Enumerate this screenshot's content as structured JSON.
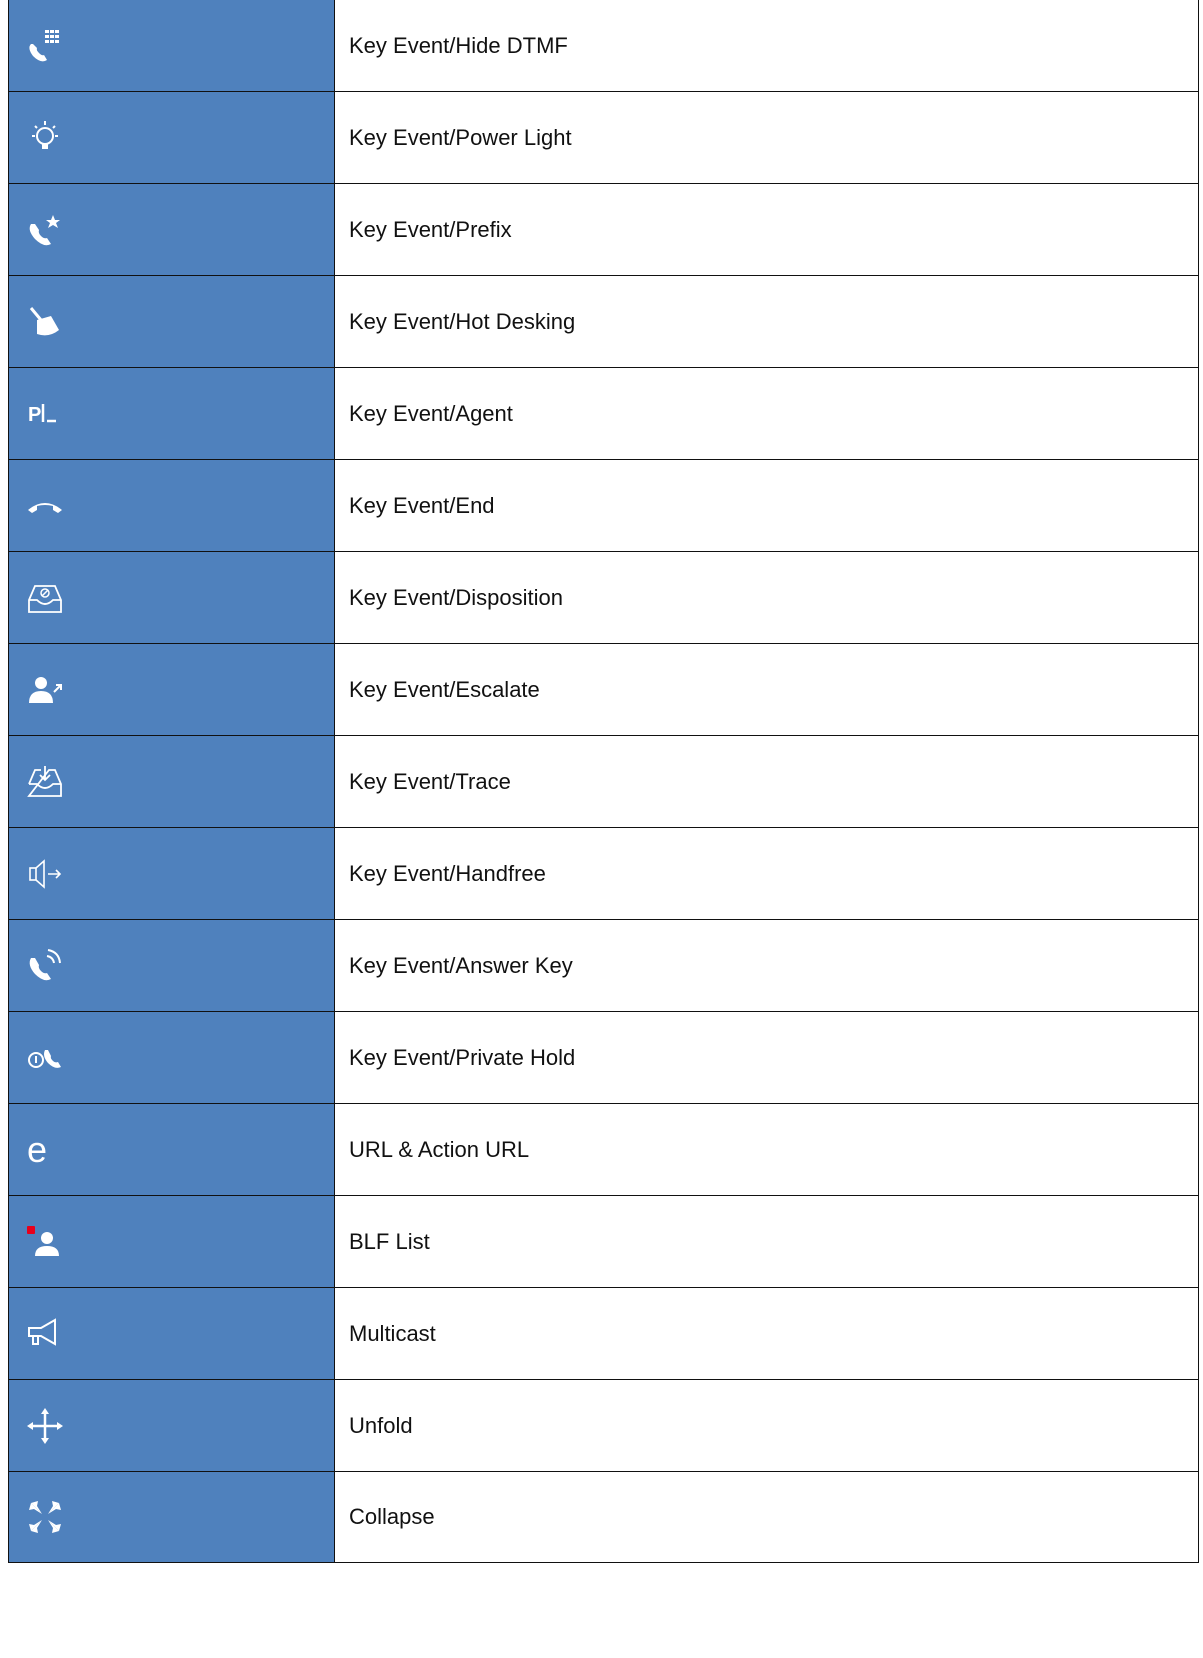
{
  "table": {
    "accent_color": "#4f81bd",
    "rows": [
      {
        "icon": "dialpad-phone-icon",
        "label": "Key Event/Hide DTMF"
      },
      {
        "icon": "light-bulb-icon",
        "label": "Key Event/Power Light"
      },
      {
        "icon": "phone-star-icon",
        "label": "Key Event/Prefix"
      },
      {
        "icon": "broom-icon",
        "label": "Key Event/Hot Desking"
      },
      {
        "icon": "agent-p-icon",
        "label": "Key Event/Agent"
      },
      {
        "icon": "end-call-icon",
        "label": "Key Event/End"
      },
      {
        "icon": "inbox-disposition-icon",
        "label": "Key Event/Disposition"
      },
      {
        "icon": "user-escalate-icon",
        "label": "Key Event/Escalate"
      },
      {
        "icon": "inbox-trace-icon",
        "label": "Key Event/Trace"
      },
      {
        "icon": "speaker-handfree-icon",
        "label": "Key Event/Handfree"
      },
      {
        "icon": "phone-ringing-icon",
        "label": "Key Event/Answer Key"
      },
      {
        "icon": "private-hold-icon",
        "label": "Key Event/Private Hold"
      },
      {
        "icon": "browser-e-icon",
        "label": "URL & Action URL"
      },
      {
        "icon": "blf-user-icon",
        "label": "BLF List"
      },
      {
        "icon": "megaphone-icon",
        "label": "Multicast"
      },
      {
        "icon": "expand-arrows-icon",
        "label": "Unfold"
      },
      {
        "icon": "collapse-arrows-icon",
        "label": "Collapse"
      }
    ]
  }
}
